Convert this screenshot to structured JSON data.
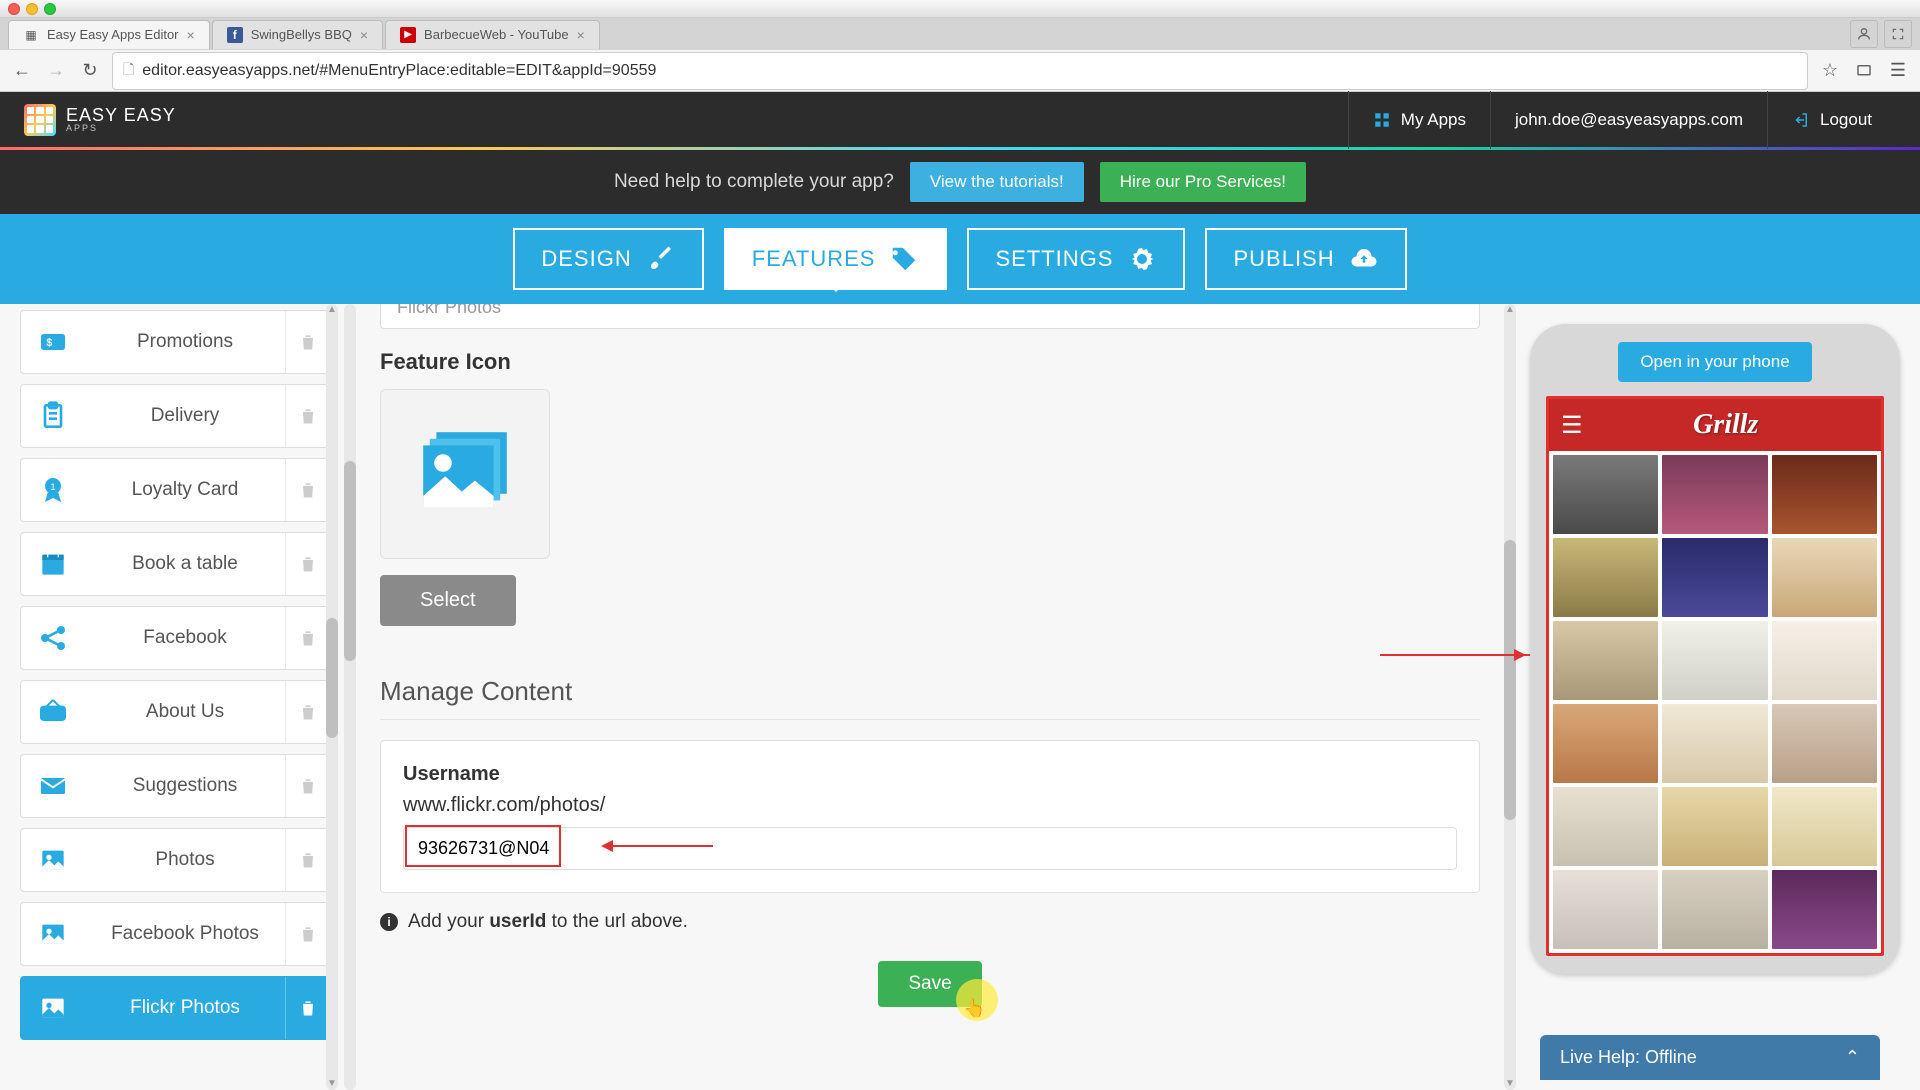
{
  "browser": {
    "tabs": [
      {
        "title": "Easy Easy Apps Editor",
        "active": true,
        "icon": "grid"
      },
      {
        "title": "SwingBellys BBQ",
        "active": false,
        "icon": "fb"
      },
      {
        "title": "BarbecueWeb - YouTube",
        "active": false,
        "icon": "yt"
      }
    ],
    "url": "editor.easyeasyapps.net/#MenuEntryPlace:editable=EDIT&appId=90559"
  },
  "header": {
    "logo_line1": "EASY EASY",
    "logo_line2": "APPS",
    "my_apps": "My Apps",
    "user_email": "john.doe@easyeasyapps.com",
    "logout": "Logout"
  },
  "help_banner": {
    "text": "Need help to complete your app?",
    "tutorials_btn": "View the tutorials!",
    "pro_btn": "Hire our Pro Services!"
  },
  "main_nav": {
    "design": "DESIGN",
    "features": "FEATURES",
    "settings": "SETTINGS",
    "publish": "PUBLISH"
  },
  "sidebar": {
    "items": [
      {
        "label": "Promotions",
        "icon": "promo"
      },
      {
        "label": "Delivery",
        "icon": "delivery"
      },
      {
        "label": "Loyalty Card",
        "icon": "loyalty"
      },
      {
        "label": "Book a table",
        "icon": "calendar"
      },
      {
        "label": "Facebook",
        "icon": "share"
      },
      {
        "label": "About Us",
        "icon": "open"
      },
      {
        "label": "Suggestions",
        "icon": "mail"
      },
      {
        "label": "Photos",
        "icon": "photo"
      },
      {
        "label": "Facebook Photos",
        "icon": "photo"
      },
      {
        "label": "Flickr Photos",
        "icon": "photo",
        "active": true
      }
    ]
  },
  "main": {
    "feature_title_value": "Flickr Photos",
    "feature_icon_heading": "Feature Icon",
    "select_btn": "Select",
    "manage_heading": "Manage Content",
    "username_label": "Username",
    "url_prefix": "www.flickr.com/photos/",
    "username_value": "93626731@N04",
    "info_text_1": "Add your ",
    "info_text_bold": "userId",
    "info_text_2": " to the url above.",
    "save_btn": "Save"
  },
  "preview": {
    "open_phone_btn": "Open in your phone",
    "app_title": "Grillz"
  },
  "live_help": {
    "text": "Live Help: Offline"
  }
}
